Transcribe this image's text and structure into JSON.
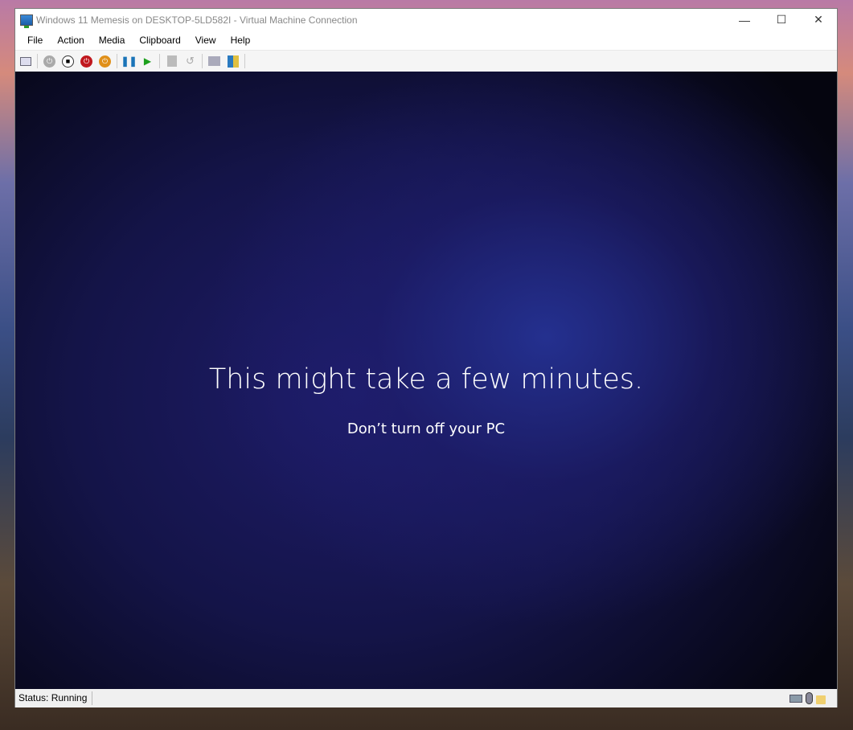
{
  "window": {
    "title": "Windows 11 Memesis on DESKTOP-5LD582I - Virtual Machine Connection",
    "minimize": "—",
    "maximize": "☐",
    "close": "✕"
  },
  "menu": [
    "File",
    "Action",
    "Media",
    "Clipboard",
    "View",
    "Help"
  ],
  "toolbar": [
    {
      "name": "ctrl-alt-del",
      "icon": "keyboard"
    },
    {
      "name": "start",
      "icon": "power-gray"
    },
    {
      "name": "turn-off",
      "icon": "stop"
    },
    {
      "name": "shut-down",
      "icon": "power-red"
    },
    {
      "name": "save",
      "icon": "power-orange"
    },
    {
      "name": "pause",
      "icon": "pause"
    },
    {
      "name": "resume",
      "icon": "play"
    },
    {
      "name": "checkpoint",
      "icon": "checkpoint"
    },
    {
      "name": "revert",
      "icon": "undo"
    },
    {
      "name": "enhanced-session",
      "icon": "monitor"
    },
    {
      "name": "share",
      "icon": "share"
    }
  ],
  "screen": {
    "heading": "This might take a few minutes.",
    "subheading": "Don’t turn off your PC"
  },
  "status": {
    "text": "Status: Running"
  }
}
